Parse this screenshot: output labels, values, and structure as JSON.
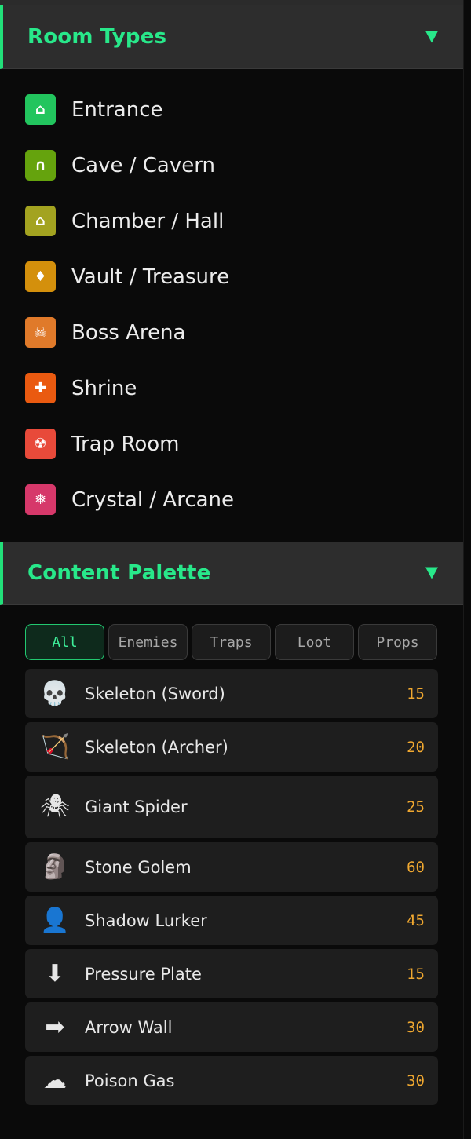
{
  "room_types": {
    "title": "Room Types",
    "accent": "#22e07a",
    "items": [
      {
        "label": "Entrance",
        "icon": "⌂",
        "color": "#22c55e"
      },
      {
        "label": "Cave / Cavern",
        "icon": "∩",
        "color": "#65a30d"
      },
      {
        "label": "Chamber / Hall",
        "icon": "⌂",
        "color": "#a3a320"
      },
      {
        "label": "Vault / Treasure",
        "icon": "♦",
        "color": "#d4900c"
      },
      {
        "label": "Boss Arena",
        "icon": "☠",
        "color": "#e07a2a"
      },
      {
        "label": "Shrine",
        "icon": "✚",
        "color": "#ea5a10"
      },
      {
        "label": "Trap Room",
        "icon": "☢",
        "color": "#e84a3a"
      },
      {
        "label": "Crystal / Arcane",
        "icon": "❅",
        "color": "#d6386a"
      }
    ]
  },
  "content_palette": {
    "title": "Content Palette",
    "filters": [
      {
        "label": "All",
        "active": true
      },
      {
        "label": "Enemies",
        "active": false
      },
      {
        "label": "Traps",
        "active": false
      },
      {
        "label": "Loot",
        "active": false
      },
      {
        "label": "Props",
        "active": false
      }
    ],
    "items": [
      {
        "icon": "💀",
        "icon_name": "skull-icon",
        "label": "Skeleton (Sword)",
        "cost": "15"
      },
      {
        "icon": "🏹",
        "icon_name": "bow-arrow-icon",
        "label": "Skeleton (Archer)",
        "cost": "20"
      },
      {
        "icon": "🕷",
        "icon_name": "spider-icon",
        "label": "Giant Spider",
        "cost": "25",
        "tall": true
      },
      {
        "icon": "🗿",
        "icon_name": "moai-statue-icon",
        "label": "Stone Golem",
        "cost": "60"
      },
      {
        "icon": "👤",
        "icon_name": "silhouette-icon",
        "label": "Shadow Lurker",
        "cost": "45"
      },
      {
        "icon": "⬇",
        "icon_name": "down-arrow-icon",
        "label": "Pressure Plate",
        "cost": "15"
      },
      {
        "icon": "➡",
        "icon_name": "right-arrow-icon",
        "label": "Arrow Wall",
        "cost": "30"
      },
      {
        "icon": "☁",
        "icon_name": "cloud-icon",
        "label": "Poison Gas",
        "cost": "30"
      }
    ]
  }
}
